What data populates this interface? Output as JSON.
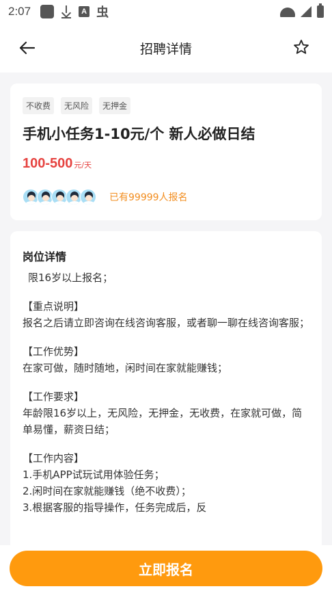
{
  "status_bar": {
    "time": "2:07",
    "icons": [
      "square-icon",
      "download-icon",
      "a-icon",
      "bug-icon",
      "wifi-icon",
      "signal-icon",
      "battery-icon"
    ],
    "a_label": "A",
    "bug_glyph": "虫"
  },
  "header": {
    "title": "招聘详情"
  },
  "job": {
    "tags": [
      "不收费",
      "无风险",
      "无押金"
    ],
    "title": "手机小任务1-10元/个 新人必做日结",
    "salary": "100-500",
    "salary_unit": "元/天",
    "applicants": "已有99999人报名"
  },
  "detail": {
    "heading": "岗位详情",
    "paragraphs": [
      "限16岁以上报名；",
      "【重点说明】",
      "报名之后请立即咨询在线咨询客服，或者聊一聊在线咨询客服；",
      "【工作优势】",
      "在家可做，随时随地，闲时间在家就能赚钱；",
      "【工作要求】",
      "年龄限16岁以上，无风险，无押金，无收费，在家就可做，简单易懂，薪资日结；",
      "【工作内容】",
      "1.手机APP试玩试用体验任务；",
      "2.闲时间在家就能赚钱（绝不收费）；",
      "3.根据客服的指导操作，任务完成后，反"
    ]
  },
  "footer": {
    "apply_label": "立即报名"
  },
  "colors": {
    "accent": "#ff9a0e",
    "salary": "#e64340",
    "applicants": "#f28c1d"
  }
}
